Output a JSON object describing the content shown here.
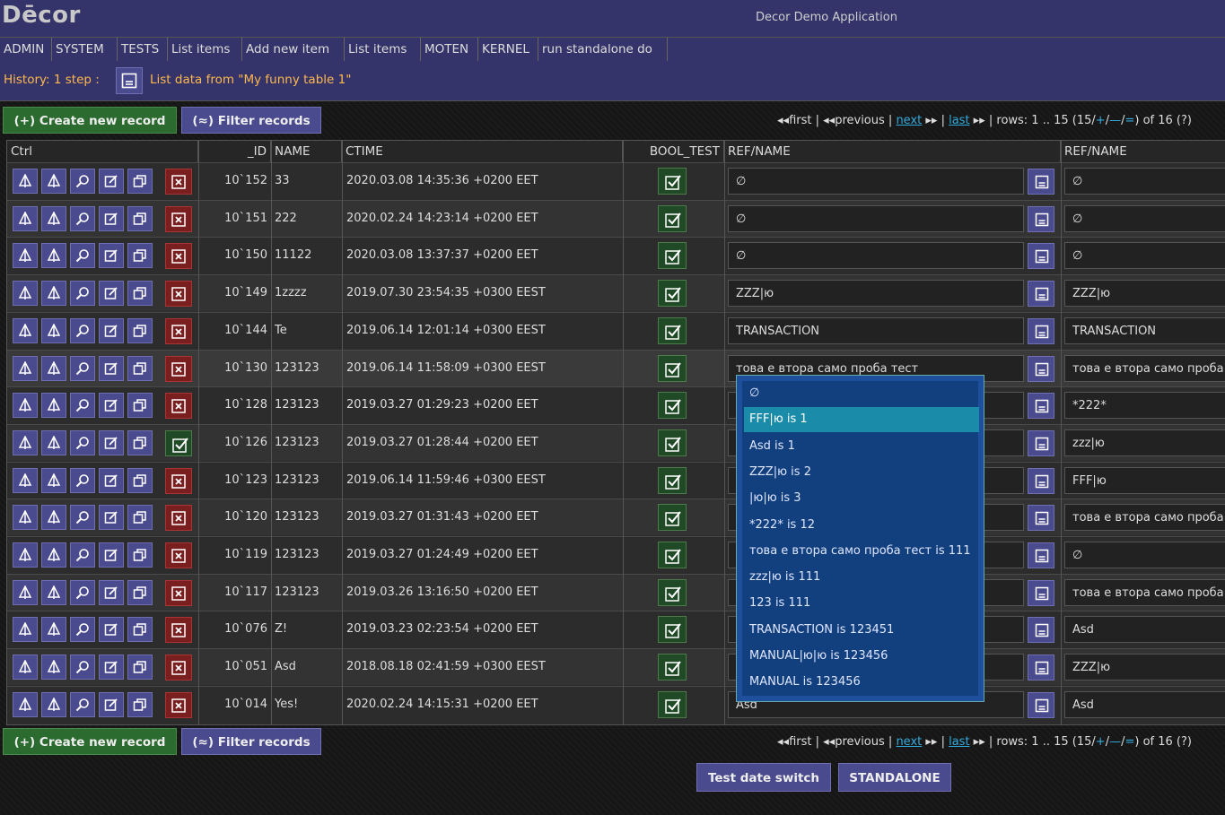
{
  "app": {
    "logo": "Dēcor",
    "title": "Decor Demo Application"
  },
  "menu": [
    "ADMIN",
    "SYSTEM",
    "TESTS",
    "List items",
    "Add new item",
    "List items",
    "MOTEN",
    "KERNEL",
    "run standalone do"
  ],
  "history": {
    "label": "History: 1 step :",
    "link": "List data from \"My funny table 1\""
  },
  "actions": {
    "create": "(+) Create new record",
    "filter": "(≈) Filter records"
  },
  "pager": {
    "first": "first",
    "sep": " | ",
    "previous": "previous",
    "next": "next",
    "last": "last",
    "rows_prefix": " | rows: 1 .. 15 (15/",
    "plus": "+",
    "slash1": "/",
    "minus": "—",
    "slash2": "/",
    "eq": "=",
    "rows_suffix": ") of 16 (?)"
  },
  "columns": {
    "ctrl": "Ctrl",
    "id": "_ID",
    "name": "NAME",
    "ctime": "CTIME",
    "bool": "BOOL_TEST",
    "ref1": "REF/NAME",
    "ref2": "REF/NAME"
  },
  "rows": [
    {
      "id": "10`152",
      "name": "33",
      "ctime": "2020.03.08 14:35:36 +0200 EET",
      "ref1": "∅",
      "ref2": "∅",
      "del_state": "delete"
    },
    {
      "id": "10`151",
      "name": "222",
      "ctime": "2020.02.24 14:23:14 +0200 EET",
      "ref1": "∅",
      "ref2": "∅",
      "del_state": "delete"
    },
    {
      "id": "10`150",
      "name": "11122",
      "ctime": "2020.03.08 13:37:37 +0200 EET",
      "ref1": "∅",
      "ref2": "∅",
      "del_state": "delete"
    },
    {
      "id": "10`149",
      "name": "1zzzz",
      "ctime": "2019.07.30 23:54:35 +0300 EEST",
      "ref1": "ZZZ|ю",
      "ref2": "ZZZ|ю",
      "del_state": "delete"
    },
    {
      "id": "10`144",
      "name": "Te",
      "ctime": "2019.06.14 12:01:14 +0300 EEST",
      "ref1": "TRANSACTION",
      "ref2": "TRANSACTION",
      "del_state": "delete"
    },
    {
      "id": "10`130",
      "name": "123123",
      "ctime": "2019.06.14 11:58:09 +0300 EEST",
      "ref1": "това е втора само проба тест",
      "ref2": "това е втора само проба",
      "del_state": "delete"
    },
    {
      "id": "10`128",
      "name": "123123",
      "ctime": "2019.03.27 01:29:23 +0200 EET",
      "ref1": "",
      "ref2": "*222*",
      "del_state": "delete"
    },
    {
      "id": "10`126",
      "name": "123123",
      "ctime": "2019.03.27 01:28:44 +0200 EET",
      "ref1": "",
      "ref2": "zzz|ю",
      "del_state": "ok"
    },
    {
      "id": "10`123",
      "name": "123123",
      "ctime": "2019.06.14 11:59:46 +0300 EEST",
      "ref1": "",
      "ref2": "FFF|ю",
      "del_state": "delete"
    },
    {
      "id": "10`120",
      "name": "123123",
      "ctime": "2019.03.27 01:31:43 +0200 EET",
      "ref1": "",
      "ref2": "това е втора само проба",
      "del_state": "delete"
    },
    {
      "id": "10`119",
      "name": "123123",
      "ctime": "2019.03.27 01:24:49 +0200 EET",
      "ref1": "",
      "ref2": "∅",
      "del_state": "delete"
    },
    {
      "id": "10`117",
      "name": "123123",
      "ctime": "2019.03.26 13:16:50 +0200 EET",
      "ref1": "",
      "ref2": "това е втора само проба",
      "del_state": "delete"
    },
    {
      "id": "10`076",
      "name": "Z!",
      "ctime": "2019.03.23 02:23:54 +0200 EET",
      "ref1": "",
      "ref2": "Asd",
      "del_state": "delete"
    },
    {
      "id": "10`051",
      "name": "Asd",
      "ctime": "2018.08.18 02:41:59 +0300 EEST",
      "ref1": "",
      "ref2": "ZZZ|ю",
      "del_state": "delete"
    },
    {
      "id": "10`014",
      "name": "Yes!",
      "ctime": "2020.02.24 14:15:31 +0200 EET",
      "ref1": "Asd",
      "ref2": "Asd",
      "del_state": "delete"
    }
  ],
  "dropdown": {
    "selected_index": 1,
    "options": [
      "∅",
      "FFF|ю is 1",
      "Asd is 1",
      "ZZZ|ю is 2",
      "|ю|ю is 3",
      "*222* is 12",
      "това е втора само проба тест is 111",
      "zzz|ю is 111",
      "123 is 111",
      "TRANSACTION is 123451",
      "MANUAL|ю|ю is 123456",
      "MANUAL is 123456"
    ]
  },
  "footer": {
    "test_date": "Test date switch",
    "standalone": "STANDALONE"
  },
  "colors": {
    "bar": "#34346a",
    "accent": "#ffb84d",
    "link": "#33aadd",
    "dropdown": "#12407f",
    "selected": "#1a8ca9"
  }
}
